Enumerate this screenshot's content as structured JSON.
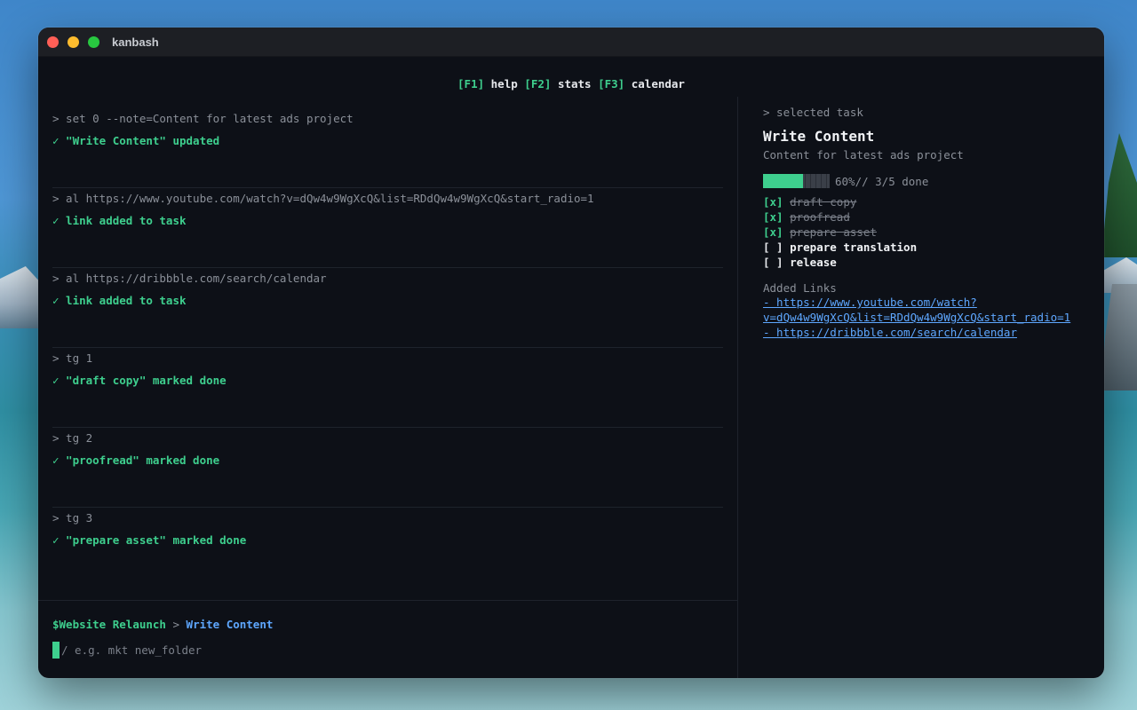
{
  "window": {
    "title": "kanbash"
  },
  "fkeys": [
    {
      "key": "[F1]",
      "label": "help"
    },
    {
      "key": "[F2]",
      "label": "stats"
    },
    {
      "key": "[F3]",
      "label": "calendar"
    }
  ],
  "log": [
    {
      "cmd": "> set 0 --note=Content for latest ads project",
      "result": "✓ \"Write Content\" updated"
    },
    {
      "cmd": "> al https://www.youtube.com/watch?v=dQw4w9WgXcQ&list=RDdQw4w9WgXcQ&start_radio=1",
      "result": "✓ link added to task"
    },
    {
      "cmd": "> al https://dribbble.com/search/calendar",
      "result": "✓ link added to task"
    },
    {
      "cmd": "> tg 1",
      "result": "✓ \"draft copy\" marked done"
    },
    {
      "cmd": "> tg 2",
      "result": "✓ \"proofread\" marked done"
    },
    {
      "cmd": "> tg 3",
      "result": "✓ \"prepare asset\" marked done"
    }
  ],
  "prompt": {
    "dollar": "$",
    "project": "Website Relaunch",
    "sep": ">",
    "task": "Write Content",
    "placeholder": "/ e.g. mkt new_folder"
  },
  "selected": {
    "header": "> selected task",
    "title": "Write Content",
    "note": "Content for latest ads project",
    "progress_fraction": 0.6,
    "progress_text": "60%// 3/5 done",
    "subtasks": [
      {
        "box": "[x]",
        "text": "draft copy",
        "done": true
      },
      {
        "box": "[x]",
        "text": "proofread",
        "done": true
      },
      {
        "box": "[x]",
        "text": "prepare asset",
        "done": true
      },
      {
        "box": "[ ]",
        "text": "prepare translation",
        "done": false
      },
      {
        "box": "[ ]",
        "text": "release",
        "done": false
      }
    ],
    "links_label": "Added Links",
    "links": [
      {
        "line1": "- https://www.youtube.com/watch?",
        "line2": "v=dQw4w9WgXcQ&list=RDdQw4w9WgXcQ&start_radio=1"
      },
      {
        "line1": "- https://dribbble.com/search/calendar"
      }
    ]
  },
  "colors": {
    "accent": "#3ecf8e",
    "link": "#5ea7ff",
    "bg": "#0d1017"
  }
}
